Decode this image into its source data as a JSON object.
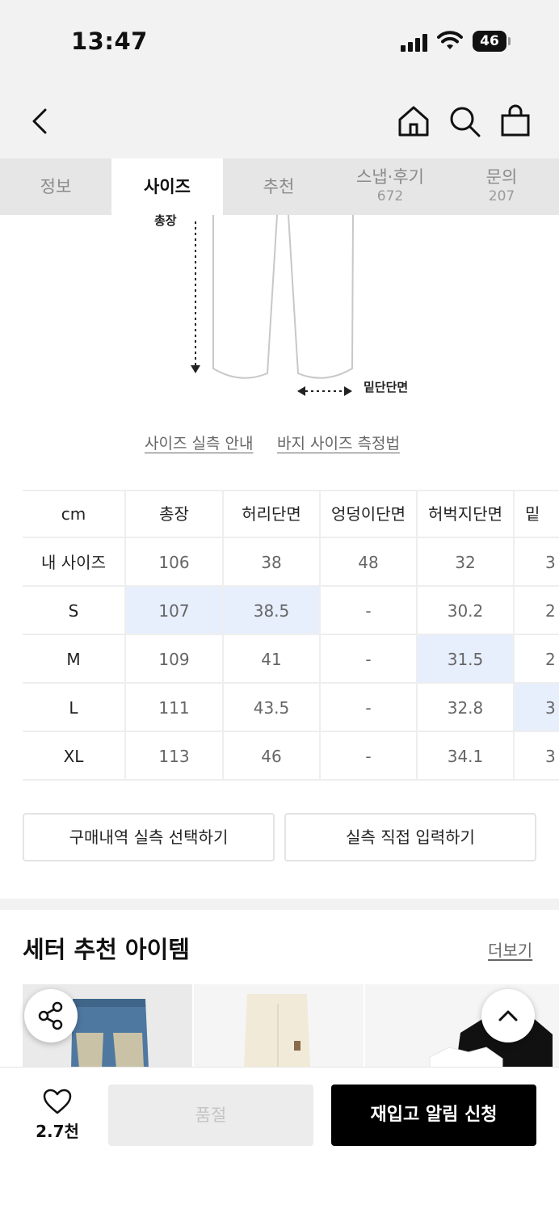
{
  "status_bar": {
    "time": "13:47",
    "battery": "46"
  },
  "header": {
    "icons": [
      "back-icon",
      "home-icon",
      "search-icon",
      "shopping-bag-icon"
    ]
  },
  "tabs": [
    {
      "label": "정보",
      "count": ""
    },
    {
      "label": "사이즈",
      "count": ""
    },
    {
      "label": "추천",
      "count": ""
    },
    {
      "label": "스냅·후기",
      "count": "672"
    },
    {
      "label": "문의",
      "count": "207"
    }
  ],
  "illustration": {
    "label_total_length": "총장",
    "label_hem": "밑단단면"
  },
  "links": {
    "size_guide": "사이즈 실측 안내",
    "pants_measure": "바지 사이즈 측정법"
  },
  "size_table": {
    "columns": [
      "cm",
      "총장",
      "허리단면",
      "엉덩이단면",
      "허벅지단면",
      "밑"
    ],
    "rows": [
      {
        "label": "내 사이즈",
        "values": [
          "106",
          "38",
          "48",
          "32",
          "3"
        ]
      },
      {
        "label": "S",
        "values": [
          "107",
          "38.5",
          "-",
          "30.2",
          "2"
        ]
      },
      {
        "label": "M",
        "values": [
          "109",
          "41",
          "-",
          "31.5",
          "2"
        ]
      },
      {
        "label": "L",
        "values": [
          "111",
          "43.5",
          "-",
          "32.8",
          "3"
        ]
      },
      {
        "label": "XL",
        "values": [
          "113",
          "46",
          "-",
          "34.1",
          "3"
        ]
      }
    ]
  },
  "buttons": {
    "purchase_history": "구매내역 실측 선택하기",
    "manual_input": "실측 직접 입력하기"
  },
  "recommend": {
    "title": "세터 추천 아이템",
    "more": "더보기"
  },
  "bottom_bar": {
    "likes": "2.7천",
    "sold_out": "품절",
    "restock": "재입고 알림 신청"
  }
}
